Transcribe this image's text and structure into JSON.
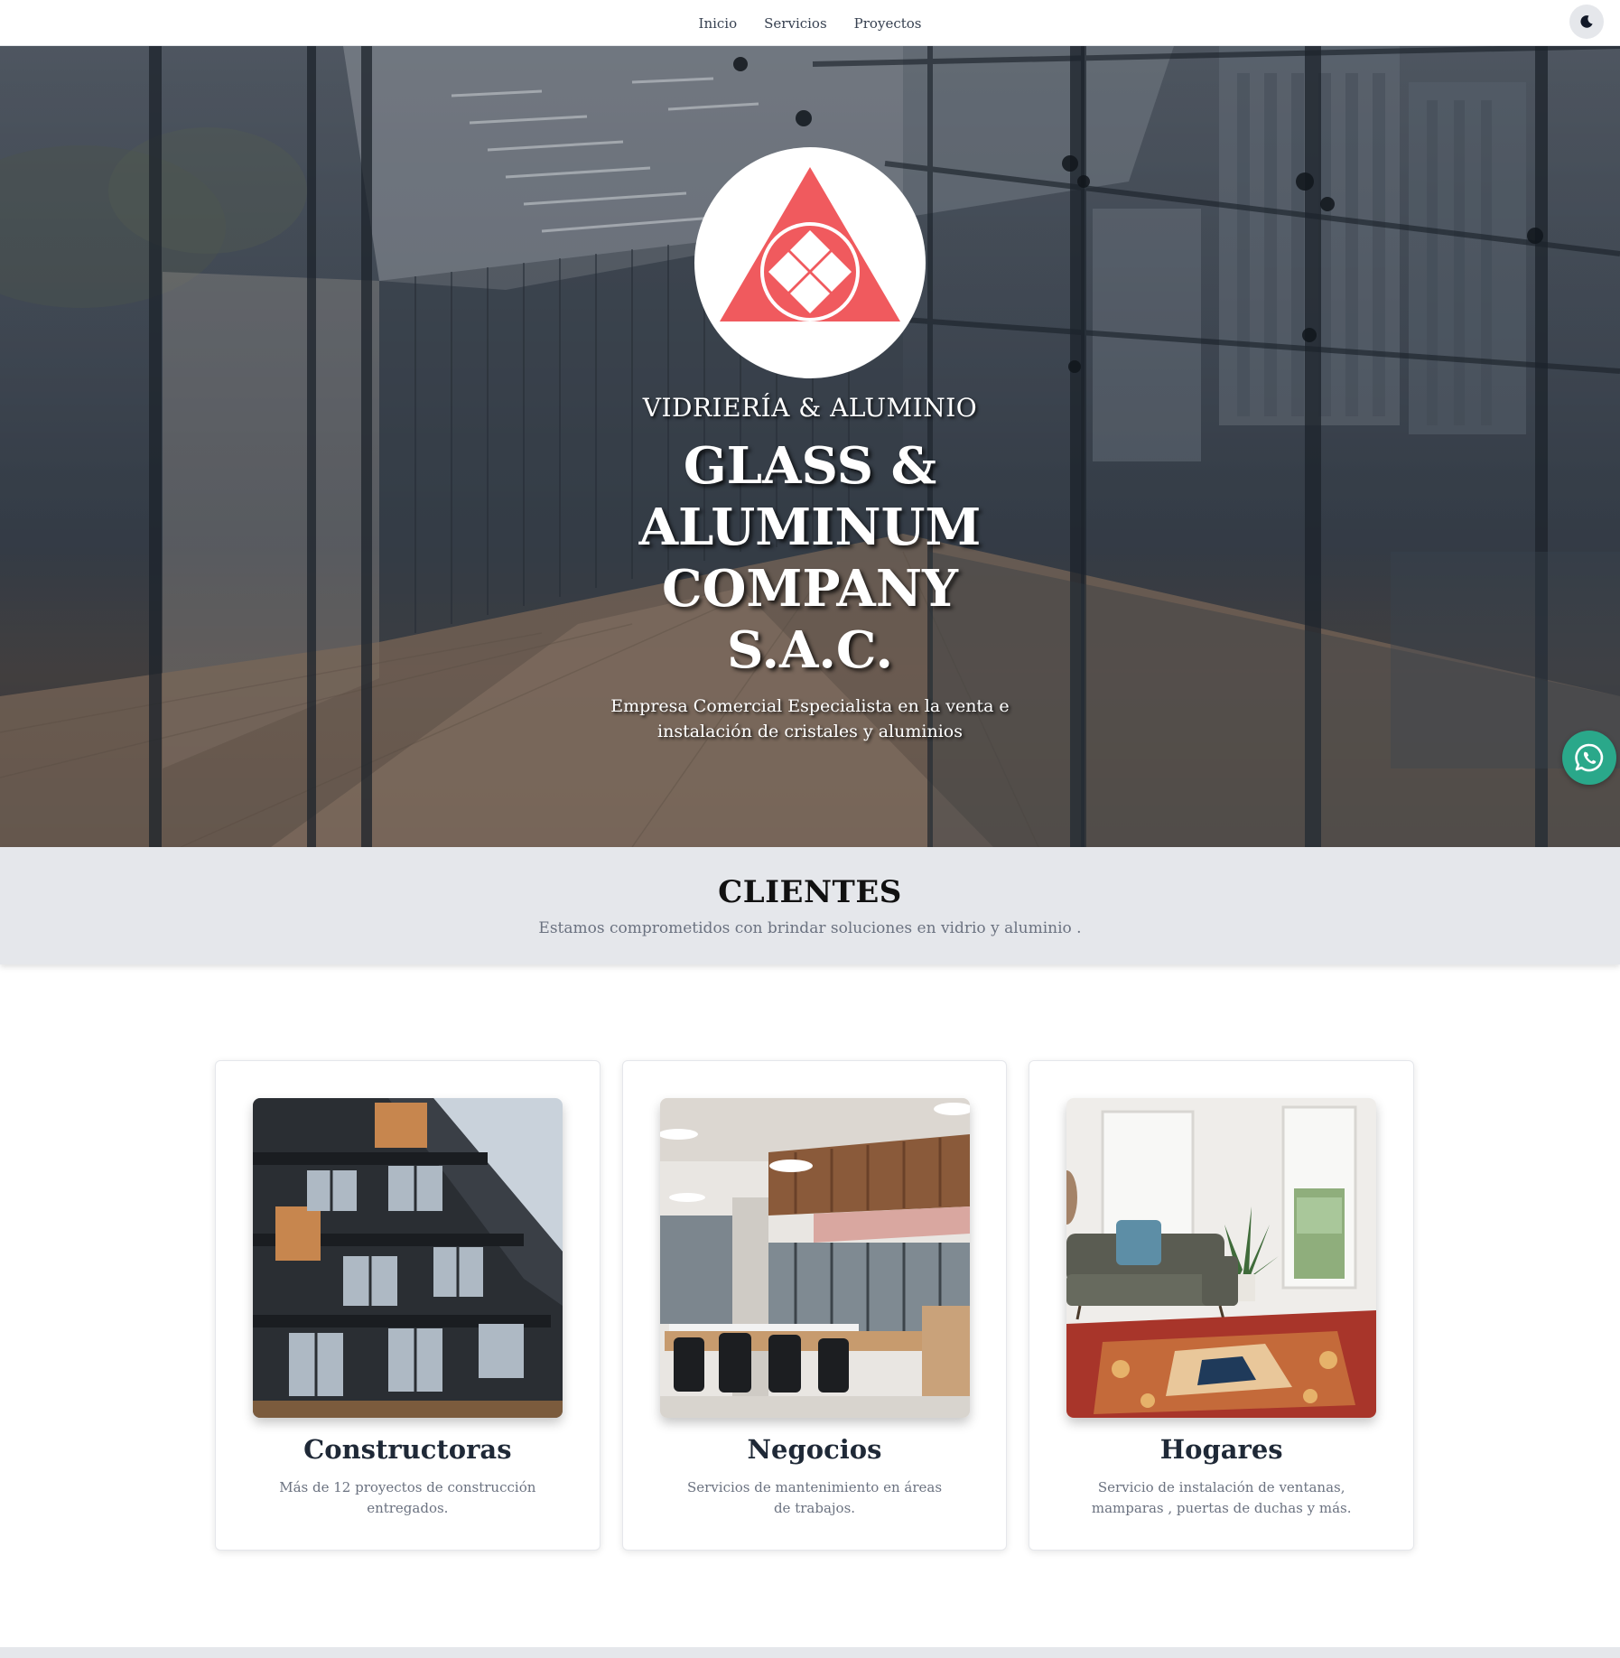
{
  "nav": {
    "links": [
      "Inicio",
      "Servicios",
      "Proyectos"
    ],
    "theme_toggle_icon": "moon-icon"
  },
  "hero": {
    "logo_icon": "triangle-diamond-logo",
    "kicker": "VIDRIERÍA & ALUMINIO",
    "title": "GLASS & ALUMINUM COMPANY S.A.C.",
    "subtitle": "Empresa Comercial Especialista en la venta e instalación de cristales y aluminios",
    "accent_color": "#f05a5e"
  },
  "whatsapp": {
    "icon": "whatsapp-icon",
    "color": "#2aa88a"
  },
  "clientes": {
    "title": "CLIENTES",
    "subtitle": "Estamos comprometidos con brindar soluciones en vidrio y aluminio ."
  },
  "cards": [
    {
      "title": "Constructoras",
      "description": "Más de 12 proyectos de construcción entregados.",
      "image": "building-facade-image"
    },
    {
      "title": "Negocios",
      "description": "Servicios de mantenimiento en áreas de trabajos.",
      "image": "office-interior-image"
    },
    {
      "title": "Hogares",
      "description": "Servicio de instalación de ventanas, mamparas , puertas de duchas y más.",
      "image": "living-room-image"
    }
  ]
}
